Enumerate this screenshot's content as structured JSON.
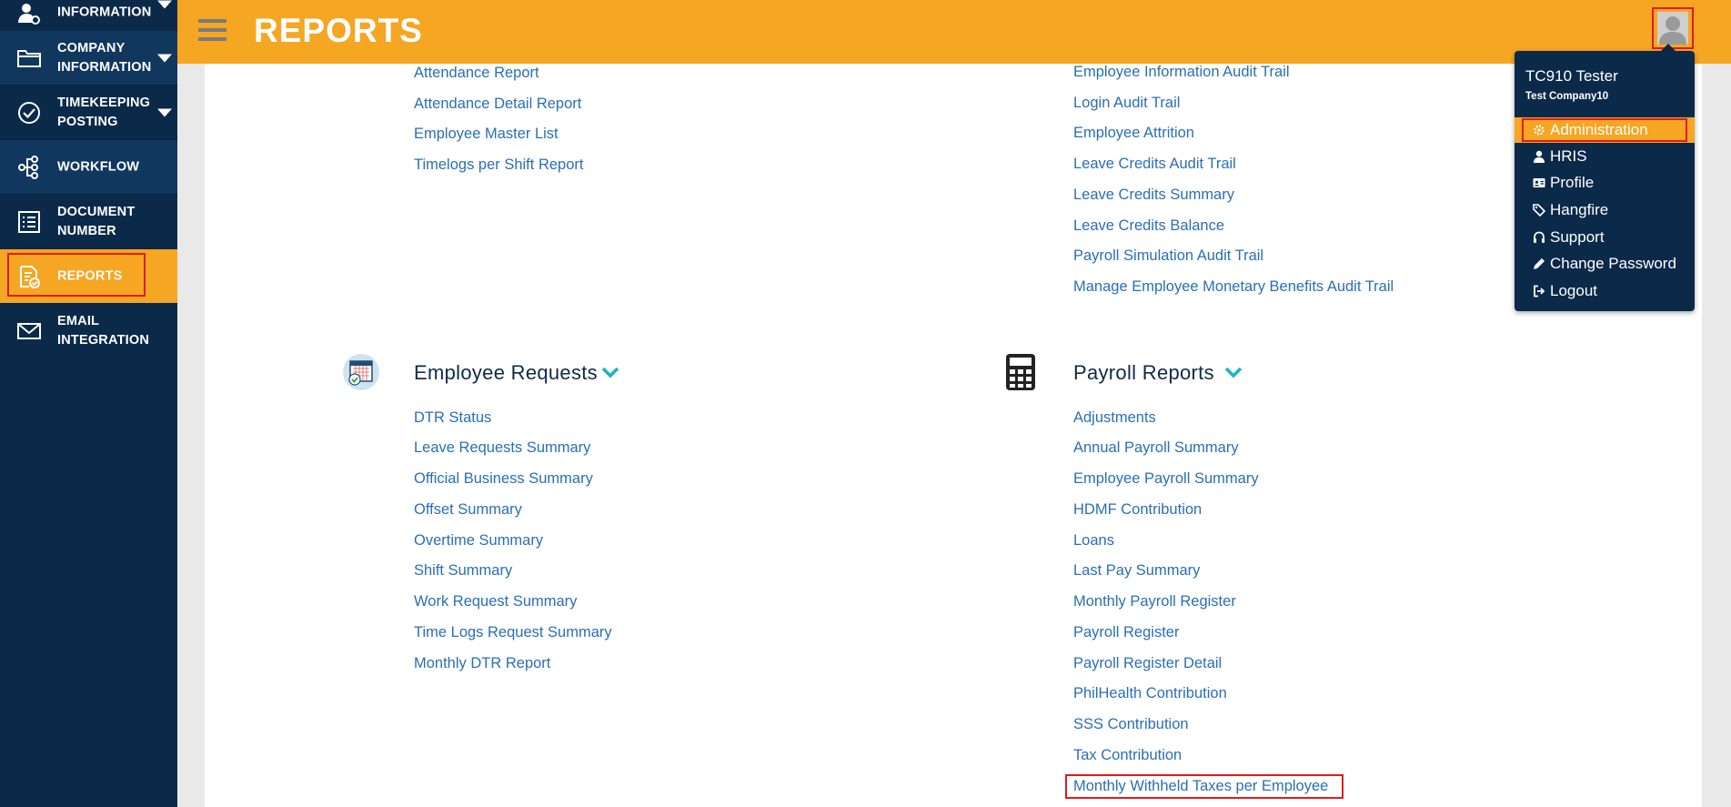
{
  "sidebar": {
    "items": [
      {
        "label_line1": "",
        "label_line2": "INFORMATION",
        "icon": "user-gear-icon"
      },
      {
        "label_line1": "COMPANY",
        "label_line2": "INFORMATION",
        "icon": "folder-icon"
      },
      {
        "label_line1": "TIMEKEEPING",
        "label_line2": "POSTING",
        "icon": "check-circle-icon"
      },
      {
        "label_line1": "WORKFLOW",
        "label_line2": "",
        "icon": "workflow-icon"
      },
      {
        "label_line1": "DOCUMENT",
        "label_line2": "NUMBER",
        "icon": "list-icon"
      },
      {
        "label_line1": "REPORTS",
        "label_line2": "",
        "icon": "report-icon"
      },
      {
        "label_line1": "EMAIL",
        "label_line2": "INTEGRATION",
        "icon": "envelope-icon"
      }
    ]
  },
  "header": {
    "title": "REPORTS"
  },
  "top_left_links": [
    "Attendance Report",
    "Attendance Detail Report",
    "Employee Master List",
    "Timelogs per Shift Report"
  ],
  "top_right_links": [
    "Employee Information Audit Trail",
    "Login Audit Trail",
    "Employee Attrition",
    "Leave Credits Audit Trail",
    "Leave Credits Summary",
    "Leave Credits Balance",
    "Payroll Simulation Audit Trail",
    "Manage Employee Monetary Benefits Audit Trail"
  ],
  "employee_requests": {
    "title": "Employee Requests",
    "links": [
      "DTR Status",
      "Leave Requests Summary",
      "Official Business Summary",
      "Offset Summary",
      "Overtime Summary",
      "Shift Summary",
      "Work Request Summary",
      "Time Logs Request Summary",
      "Monthly DTR Report"
    ]
  },
  "payroll_reports": {
    "title": "Payroll Reports",
    "links": [
      "Adjustments",
      "Annual Payroll Summary",
      "Employee Payroll Summary",
      "HDMF Contribution",
      "Loans",
      "Last Pay Summary",
      "Monthly Payroll Register",
      "Payroll Register",
      "Payroll Register Detail",
      "PhilHealth Contribution",
      "SSS Contribution",
      "Tax Contribution",
      "Monthly Withheld Taxes per Employee"
    ]
  },
  "user_menu": {
    "user_name": "TC910 Tester",
    "company": "Test Company10",
    "items": [
      {
        "label": "Administration",
        "icon": "gear-icon"
      },
      {
        "label": "HRIS",
        "icon": "user-icon"
      },
      {
        "label": "Profile",
        "icon": "id-card-icon"
      },
      {
        "label": "Hangfire",
        "icon": "tags-icon"
      },
      {
        "label": "Support",
        "icon": "headset-icon"
      },
      {
        "label": "Change Password",
        "icon": "pencil-icon"
      },
      {
        "label": "Logout",
        "icon": "logout-icon"
      }
    ]
  },
  "colors": {
    "accent": "#f5a623",
    "sidebar": "#0b2a4a",
    "link": "#2a6fb5",
    "highlight": "#e31b1b"
  }
}
